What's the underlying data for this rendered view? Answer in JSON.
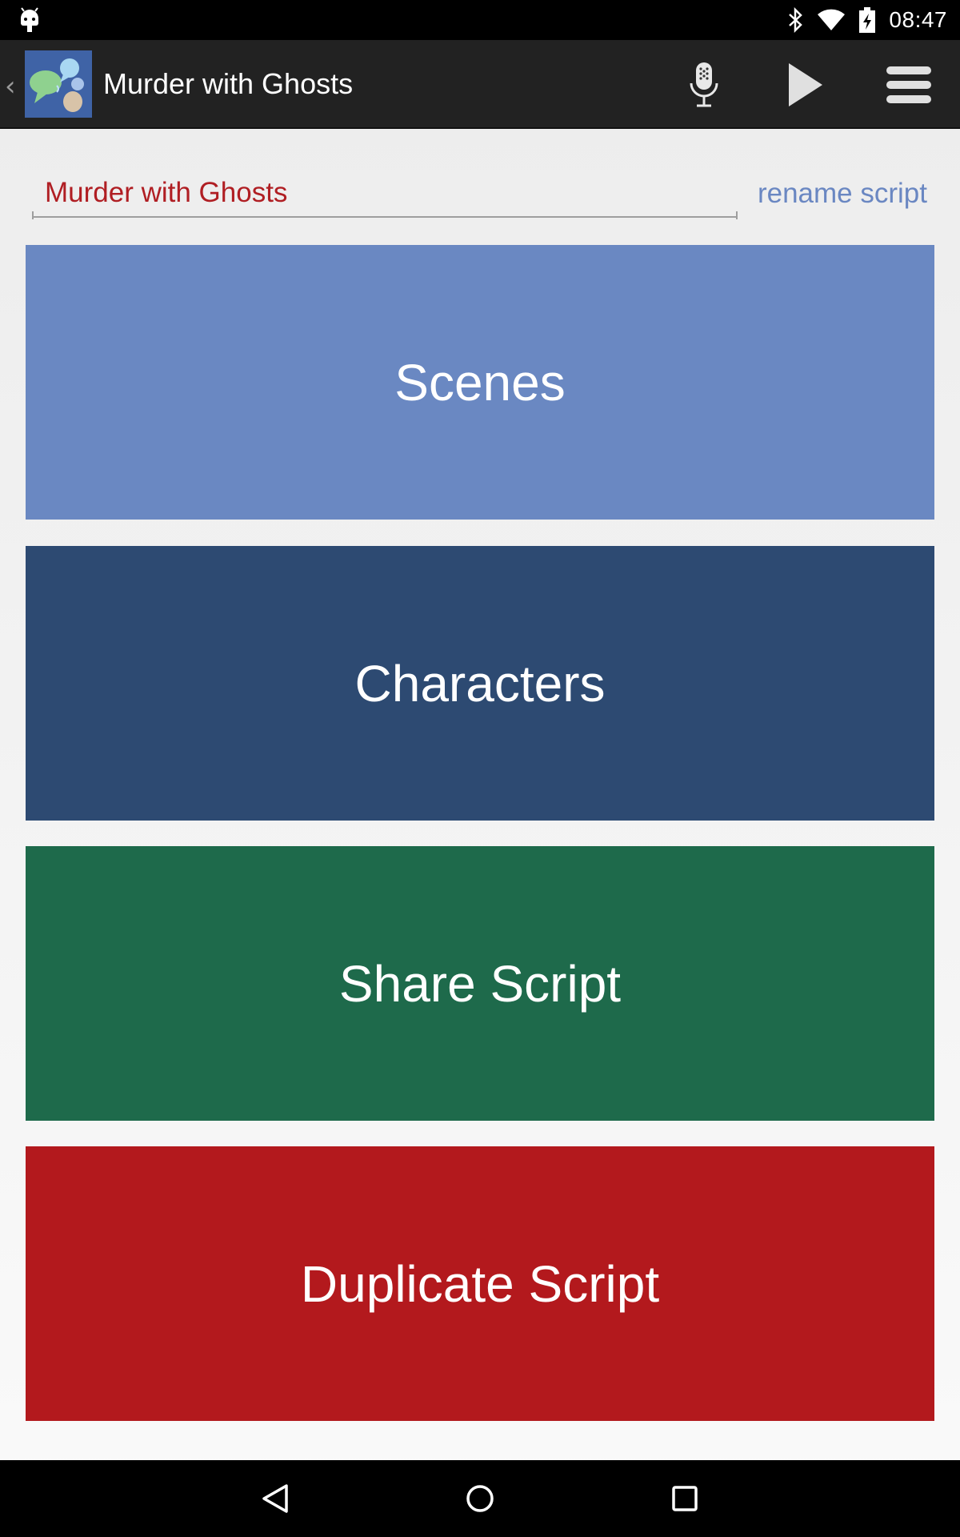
{
  "status_bar": {
    "time": "08:47",
    "icons": [
      "android-debug-icon",
      "bluetooth-icon",
      "wifi-icon",
      "battery-charging-icon"
    ]
  },
  "action_bar": {
    "title": "Murder with Ghosts",
    "up_icon": "chevron-left-icon",
    "app_icon": "speech-bubbles-app-icon",
    "actions": [
      "microphone-icon",
      "play-icon",
      "menu-icon"
    ]
  },
  "script_name": {
    "value": "Murder with Ghosts",
    "rename_label": "rename script"
  },
  "buttons": {
    "scenes": "Scenes",
    "characters": "Characters",
    "share": "Share Script",
    "duplicate": "Duplicate Script"
  },
  "colors": {
    "scenes": "#6a88c2",
    "characters": "#2d4a72",
    "share": "#1e6a4b",
    "duplicate": "#b3191d",
    "script_name_text": "#b01e23",
    "rename_link": "#6a87c2",
    "action_bar": "#222222"
  },
  "nav_bar": {
    "icons": [
      "back-triangle-icon",
      "home-circle-icon",
      "recents-square-icon"
    ]
  }
}
